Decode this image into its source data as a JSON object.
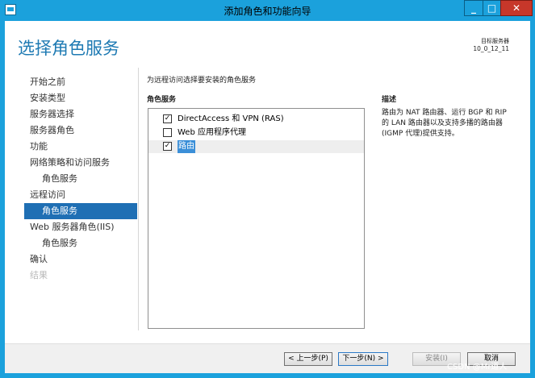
{
  "window": {
    "title": "添加角色和功能向导"
  },
  "header": {
    "title": "选择角色服务",
    "target_label": "目标服务器",
    "target_value": "10_0_12_11"
  },
  "nav": {
    "items": [
      {
        "label": "开始之前"
      },
      {
        "label": "安装类型"
      },
      {
        "label": "服务器选择"
      },
      {
        "label": "服务器角色"
      },
      {
        "label": "功能"
      },
      {
        "label": "网络策略和访问服务"
      },
      {
        "label": "角色服务"
      },
      {
        "label": "远程访问"
      },
      {
        "label": "角色服务"
      },
      {
        "label": "Web 服务器角色(IIS)"
      },
      {
        "label": "角色服务"
      },
      {
        "label": "确认"
      },
      {
        "label": "结果"
      }
    ]
  },
  "main": {
    "instruction": "为远程访问选择要安装的角色服务",
    "roles_header": "角色服务",
    "roles": [
      {
        "label": "DirectAccess 和 VPN (RAS)",
        "checked": "✓"
      },
      {
        "label": "Web 应用程序代理",
        "checked": ""
      },
      {
        "label": "路由",
        "checked": "✓"
      }
    ],
    "description_header": "描述",
    "description": "路由为 NAT 路由器、运行 BGP 和 RIP 的 LAN 路由器以及支持多播的路由器(IGMP 代理)提供支持。"
  },
  "footer": {
    "prev_label": "< 上一步(P)",
    "next_label": "下一步(N) >",
    "install_label": "安装(I)",
    "cancel_label": "取消"
  },
  "watermark": "CSDN @Mr道人"
}
